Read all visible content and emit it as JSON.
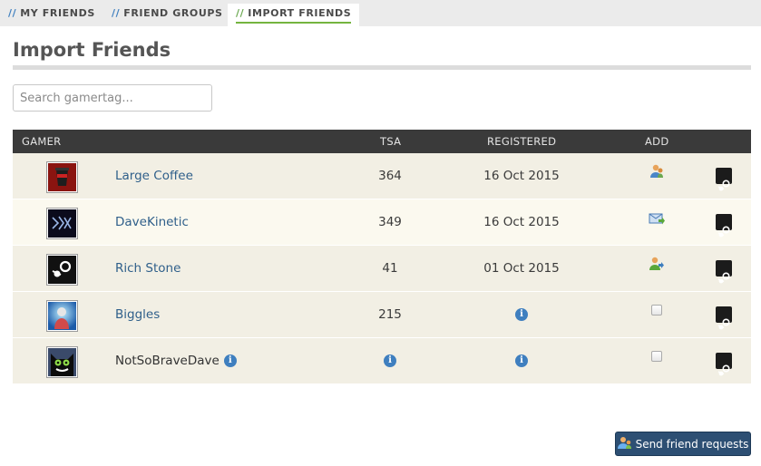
{
  "tabs": [
    {
      "slashes": "//",
      "label": "MY FRIENDS"
    },
    {
      "slashes": "//",
      "label": "FRIEND GROUPS"
    },
    {
      "slashes": "//",
      "label": "IMPORT FRIENDS",
      "active": true
    }
  ],
  "page_title": "Import Friends",
  "search": {
    "placeholder": "Search gamertag...",
    "value": ""
  },
  "table": {
    "headers": {
      "gamer": "GAMER",
      "tsa": "TSA",
      "registered": "REGISTERED",
      "add": "ADD"
    },
    "rows": [
      {
        "name": "Large Coffee",
        "tsa": "364",
        "registered": "16 Oct 2015",
        "add": "add-friend-icon",
        "avatar": "coffee-cup-avatar"
      },
      {
        "name": "DaveKinetic",
        "tsa": "349",
        "registered": "16 Oct 2015",
        "add": "friend-request-sent-icon",
        "avatar": "dk-logo-avatar"
      },
      {
        "name": "Rich Stone",
        "tsa": "41",
        "registered": "01 Oct 2015",
        "add": "add-friend-icon",
        "avatar": "steam-logo-avatar"
      },
      {
        "name": "Biggles",
        "tsa": "215",
        "registered": "",
        "add": "checkbox",
        "avatar": "glowing-figure-avatar"
      },
      {
        "name": "NotSoBraveDave",
        "tsa": "",
        "registered": "",
        "add": "checkbox",
        "avatar": "black-cat-avatar"
      }
    ]
  },
  "send_button": {
    "label": "Send friend requests"
  },
  "colors": {
    "header_bg": "#3a3a3a",
    "link": "#2f5f8a",
    "accent_green": "#74b43f",
    "button_bg": "#2d4f73",
    "info_blue": "#3f7fbf"
  }
}
